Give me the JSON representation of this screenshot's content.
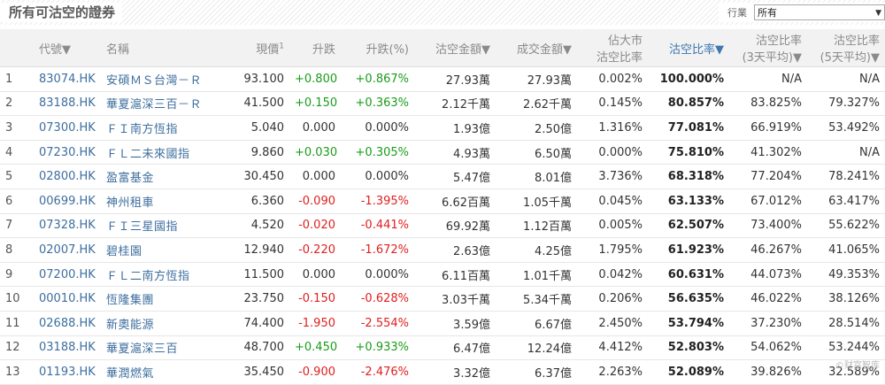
{
  "title": "所有可沽空的證券",
  "filter": {
    "label": "行業",
    "selected": "所有"
  },
  "watermark": "©财富智库",
  "headers": {
    "no": "",
    "code": "代號▼",
    "name": "名稱",
    "price": "現價",
    "price_sup": "1",
    "change": "升跌",
    "change_pct": "升跌(%)",
    "short_amt": "沽空金額▼",
    "turnover": "成交金額▼",
    "mkt_ratio_1": "佔大市",
    "mkt_ratio_2": "沽空比率",
    "short_ratio": "沽空比率▼",
    "ratio3_1": "沽空比率",
    "ratio3_2": "(3天平均)▼",
    "ratio5_1": "沽空比率",
    "ratio5_2": "(5天平均)▼"
  },
  "rows": [
    {
      "no": "1",
      "code": "83074.HK",
      "name": "安碩ＭＳ台灣－Ｒ",
      "price": "93.100",
      "change": "+0.800",
      "pct": "+0.867%",
      "dir": "up",
      "short": "27.93萬",
      "turnover": "27.93萬",
      "mkt": "0.002%",
      "ratio": "100.000%",
      "r3": "N/A",
      "r5": "N/A"
    },
    {
      "no": "2",
      "code": "83188.HK",
      "name": "華夏滬深三百－Ｒ",
      "price": "41.500",
      "change": "+0.150",
      "pct": "+0.363%",
      "dir": "up",
      "short": "2.12千萬",
      "turnover": "2.62千萬",
      "mkt": "0.145%",
      "ratio": "80.857%",
      "r3": "83.825%",
      "r5": "79.327%"
    },
    {
      "no": "3",
      "code": "07300.HK",
      "name": "ＦＩ南方恆指",
      "price": "5.040",
      "change": "0.000",
      "pct": "0.000%",
      "dir": "flat",
      "short": "1.93億",
      "turnover": "2.50億",
      "mkt": "1.316%",
      "ratio": "77.081%",
      "r3": "66.919%",
      "r5": "53.492%"
    },
    {
      "no": "4",
      "code": "07230.HK",
      "name": "ＦＬ二未來國指",
      "price": "9.860",
      "change": "+0.030",
      "pct": "+0.305%",
      "dir": "up",
      "short": "4.93萬",
      "turnover": "6.50萬",
      "mkt": "0.000%",
      "ratio": "75.810%",
      "r3": "41.302%",
      "r5": "N/A"
    },
    {
      "no": "5",
      "code": "02800.HK",
      "name": "盈富基金",
      "price": "30.450",
      "change": "0.000",
      "pct": "0.000%",
      "dir": "flat",
      "short": "5.47億",
      "turnover": "8.01億",
      "mkt": "3.736%",
      "ratio": "68.318%",
      "r3": "77.204%",
      "r5": "78.241%"
    },
    {
      "no": "6",
      "code": "00699.HK",
      "name": "神州租車",
      "price": "6.360",
      "change": "-0.090",
      "pct": "-1.395%",
      "dir": "down",
      "short": "6.62百萬",
      "turnover": "1.05千萬",
      "mkt": "0.045%",
      "ratio": "63.133%",
      "r3": "67.012%",
      "r5": "63.417%"
    },
    {
      "no": "7",
      "code": "07328.HK",
      "name": "ＦＩ三星國指",
      "price": "4.520",
      "change": "-0.020",
      "pct": "-0.441%",
      "dir": "down",
      "short": "69.92萬",
      "turnover": "1.12百萬",
      "mkt": "0.005%",
      "ratio": "62.507%",
      "r3": "73.400%",
      "r5": "55.622%"
    },
    {
      "no": "8",
      "code": "02007.HK",
      "name": "碧桂園",
      "price": "12.940",
      "change": "-0.220",
      "pct": "-1.672%",
      "dir": "down",
      "short": "2.63億",
      "turnover": "4.25億",
      "mkt": "1.795%",
      "ratio": "61.923%",
      "r3": "46.267%",
      "r5": "41.065%"
    },
    {
      "no": "9",
      "code": "07200.HK",
      "name": "ＦＬ二南方恆指",
      "price": "11.500",
      "change": "0.000",
      "pct": "0.000%",
      "dir": "flat",
      "short": "6.11百萬",
      "turnover": "1.01千萬",
      "mkt": "0.042%",
      "ratio": "60.631%",
      "r3": "44.073%",
      "r5": "49.353%"
    },
    {
      "no": "10",
      "code": "00010.HK",
      "name": "恆隆集團",
      "price": "23.750",
      "change": "-0.150",
      "pct": "-0.628%",
      "dir": "down",
      "short": "3.03千萬",
      "turnover": "5.34千萬",
      "mkt": "0.206%",
      "ratio": "56.635%",
      "r3": "46.022%",
      "r5": "38.126%"
    },
    {
      "no": "11",
      "code": "02688.HK",
      "name": "新奧能源",
      "price": "74.400",
      "change": "-1.950",
      "pct": "-2.554%",
      "dir": "down",
      "short": "3.59億",
      "turnover": "6.67億",
      "mkt": "2.450%",
      "ratio": "53.794%",
      "r3": "37.230%",
      "r5": "28.514%"
    },
    {
      "no": "12",
      "code": "03188.HK",
      "name": "華夏滬深三百",
      "price": "48.700",
      "change": "+0.450",
      "pct": "+0.933%",
      "dir": "up",
      "short": "6.47億",
      "turnover": "12.24億",
      "mkt": "4.412%",
      "ratio": "52.803%",
      "r3": "54.062%",
      "r5": "53.244%"
    },
    {
      "no": "13",
      "code": "01193.HK",
      "name": "華潤燃氣",
      "price": "35.450",
      "change": "-0.900",
      "pct": "-2.476%",
      "dir": "down",
      "short": "3.32億",
      "turnover": "6.37億",
      "mkt": "2.263%",
      "ratio": "52.089%",
      "r3": "39.826%",
      "r5": "32.589%"
    }
  ]
}
